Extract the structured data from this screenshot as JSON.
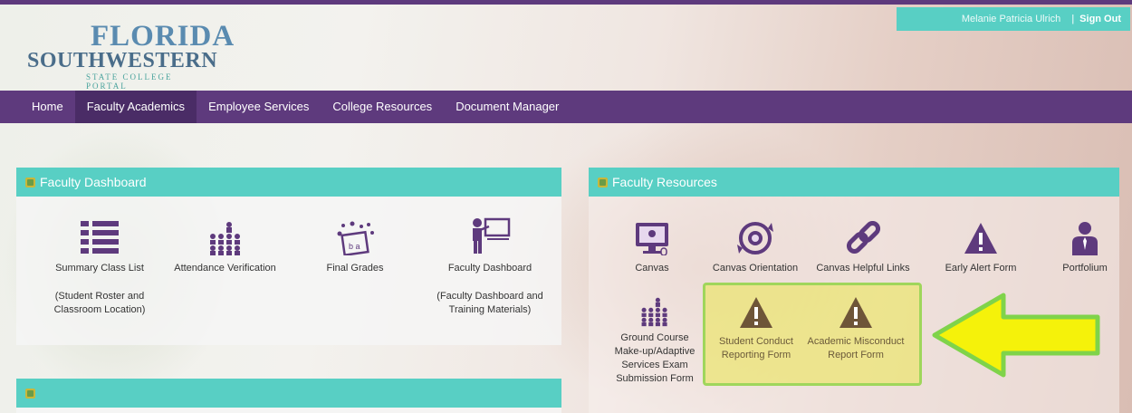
{
  "user": {
    "name": "Melanie Patricia Ulrich",
    "separator": "|",
    "signout": "Sign Out"
  },
  "logo": {
    "line1": "FLORIDA",
    "line2": "SOUTHWESTERN",
    "line3": "STATE COLLEGE PORTAL"
  },
  "nav": {
    "items": [
      "Home",
      "Faculty Academics",
      "Employee Services",
      "College Resources",
      "Document Manager"
    ],
    "active": "Faculty Academics"
  },
  "dashboard": {
    "title": "Faculty Dashboard",
    "tiles": [
      {
        "label": "Summary Class List",
        "sub": "(Student Roster and Classroom Location)",
        "icon": "list-icon"
      },
      {
        "label": "Attendance Verification",
        "sub": "",
        "icon": "audience-icon"
      },
      {
        "label": "Final Grades",
        "sub": "",
        "icon": "grades-icon"
      },
      {
        "label": "Faculty Dashboard",
        "sub": "(Faculty Dashboard and Training Materials)",
        "icon": "teacher-icon"
      }
    ]
  },
  "resources": {
    "title": "Faculty Resources",
    "tiles": [
      {
        "label": "Canvas",
        "icon": "monitor-icon"
      },
      {
        "label": "Canvas Orientation",
        "icon": "orientation-icon"
      },
      {
        "label": "Canvas Helpful Links",
        "icon": "link-icon"
      },
      {
        "label": "Early Alert Form",
        "icon": "warning-icon"
      },
      {
        "label": "Portfolium",
        "icon": "person-icon"
      },
      {
        "label": "Ground Course Make-up/Adaptive Services Exam Submission Form",
        "icon": "audience-icon"
      },
      {
        "label": "Student Conduct Reporting Form",
        "icon": "warning-icon"
      },
      {
        "label": "Academic Misconduct Report Form",
        "icon": "warning-icon"
      }
    ]
  },
  "colors": {
    "purple": "#5e3a7d",
    "teal": "#58cfc4",
    "highlight": "#ebe65a",
    "arrow": "#f5f20a"
  }
}
